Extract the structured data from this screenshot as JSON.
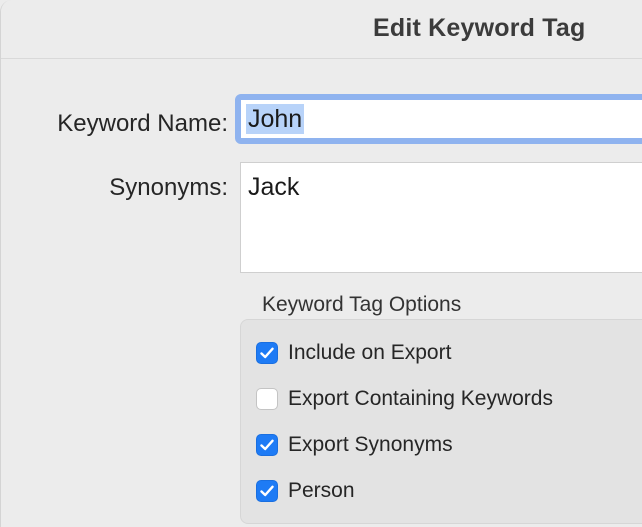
{
  "window": {
    "title": "Edit Keyword Tag"
  },
  "form": {
    "keyword_name_label": "Keyword Name:",
    "keyword_name_value": "John",
    "synonyms_label": "Synonyms:",
    "synonyms_value": "Jack"
  },
  "options": {
    "group_title": "Keyword Tag Options",
    "items": [
      {
        "label": "Include on Export",
        "checked": true
      },
      {
        "label": "Export Containing Keywords",
        "checked": false
      },
      {
        "label": "Export Synonyms",
        "checked": true
      },
      {
        "label": "Person",
        "checked": true
      }
    ]
  },
  "colors": {
    "accent": "#1e7bf5",
    "focus_ring": "#8fb3ef",
    "selection": "#b8d3f9",
    "window_bg": "#ececec"
  },
  "icons": {
    "checkmark": "checkmark-icon"
  }
}
